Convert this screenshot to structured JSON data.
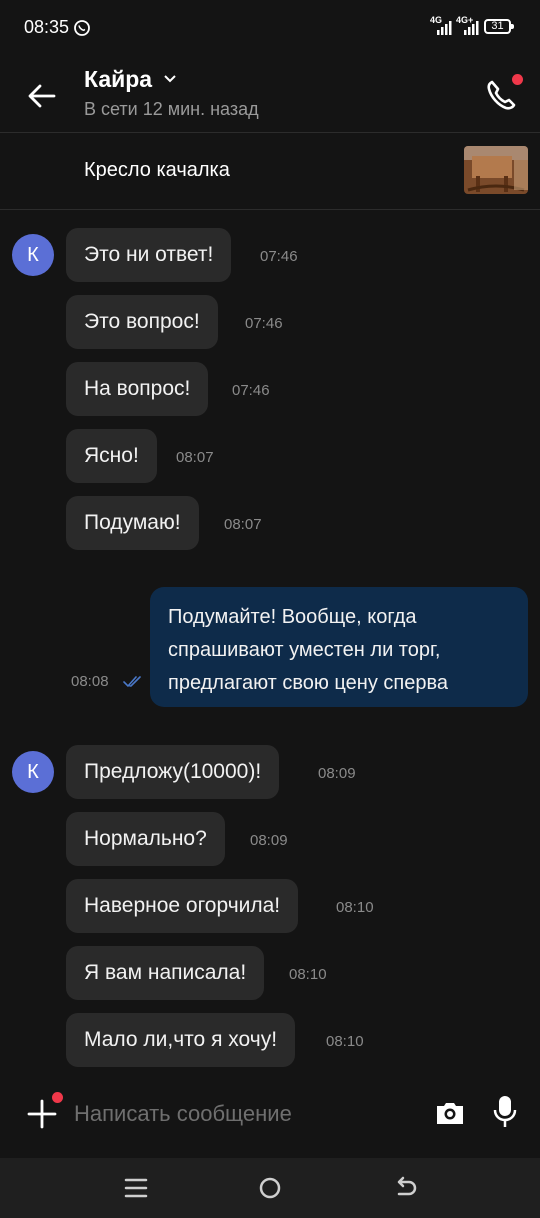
{
  "status_bar": {
    "time": "08:35",
    "network_1": "4G",
    "network_2": "4G+",
    "battery": "31"
  },
  "header": {
    "contact_name": "Кайра",
    "contact_status": "В сети 12 мин. назад"
  },
  "listing": {
    "title": "Кресло качалка"
  },
  "avatar_letter": "К",
  "messages_group1": [
    {
      "text": "Это ни ответ!",
      "time": "07:46"
    },
    {
      "text": "Это вопрос!",
      "time": "07:46"
    },
    {
      "text": "На вопрос!",
      "time": "07:46"
    },
    {
      "text": "Ясно!",
      "time": "08:07"
    },
    {
      "text": "Подумаю!",
      "time": "08:07"
    }
  ],
  "outgoing": {
    "lines": [
      "Подумайте! Вообще, когда",
      "спрашивают уместен ли торг,",
      "предлагают свою цену сперва"
    ],
    "time": "08:08"
  },
  "messages_group2": [
    {
      "text": "Предложу(10000)!",
      "time": "08:09"
    },
    {
      "text": "Нормально?",
      "time": "08:09"
    },
    {
      "text": "Наверное огорчила!",
      "time": "08:10"
    },
    {
      "text": "Я вам написала!",
      "time": "08:10"
    },
    {
      "text": "Мало ли,что я хочу!",
      "time": "08:10"
    }
  ],
  "composer": {
    "placeholder": "Написать сообщение"
  },
  "colors": {
    "accent": "#5b6fd6",
    "outgoing_bubble": "#0e2b4a",
    "incoming_bubble": "#2a2a2a",
    "badge": "#f0384a"
  }
}
